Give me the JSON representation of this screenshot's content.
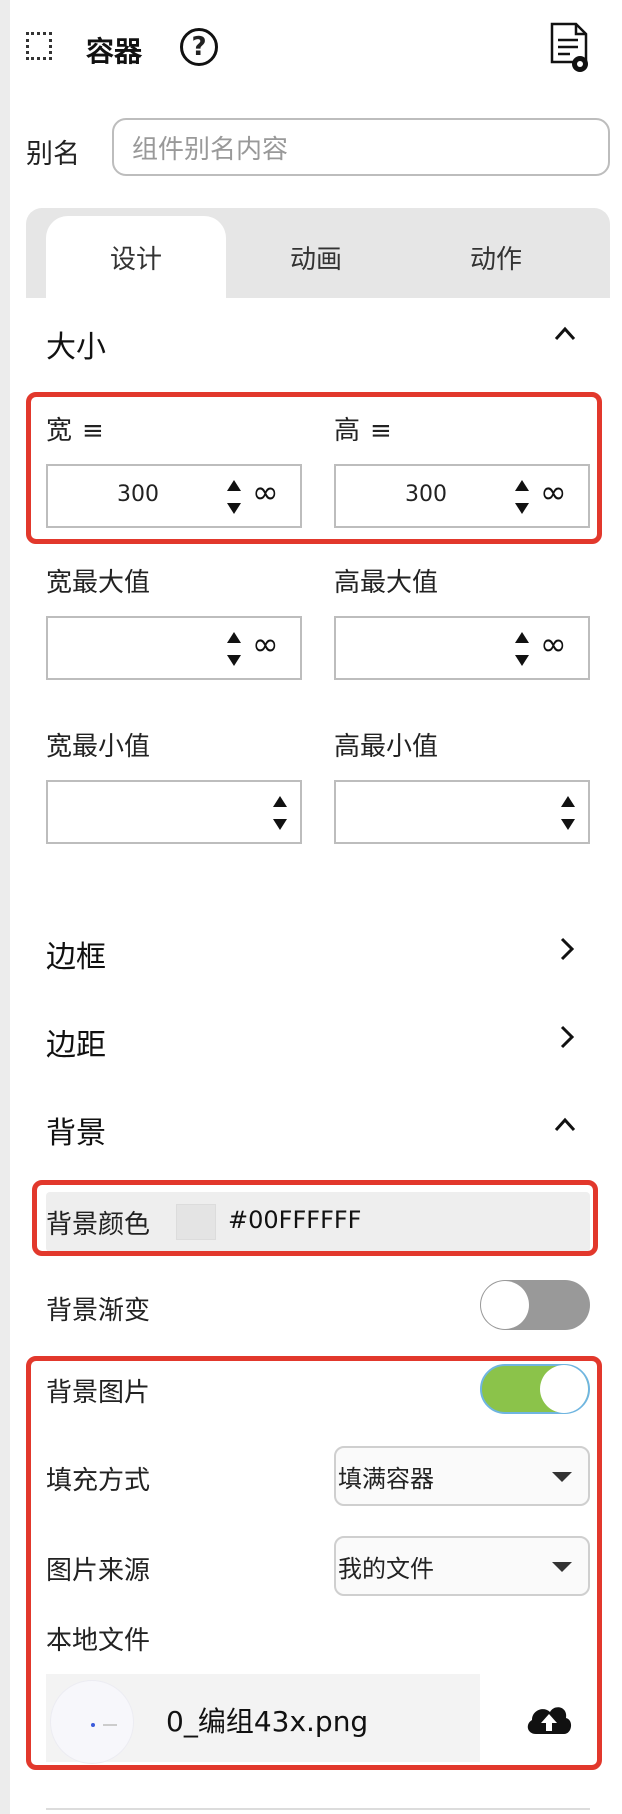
{
  "header": {
    "title": "容器",
    "help_icon_glyph": "?"
  },
  "alias": {
    "label": "别名",
    "placeholder": "组件别名内容"
  },
  "tabs": [
    {
      "label": "设计",
      "active": true
    },
    {
      "label": "动画",
      "active": false
    },
    {
      "label": "动作",
      "active": false
    }
  ],
  "size_section": {
    "title": "大小",
    "expanded": true,
    "width": {
      "label": "宽",
      "value": "300"
    },
    "height": {
      "label": "高",
      "value": "300"
    },
    "max_width": {
      "label": "宽最大值",
      "value": ""
    },
    "max_height": {
      "label": "高最大值",
      "value": ""
    },
    "min_width": {
      "label": "宽最小值",
      "value": ""
    },
    "min_height": {
      "label": "高最小值",
      "value": ""
    },
    "unit_glyph": "≡",
    "infinity_glyph": "∞"
  },
  "border_section": {
    "title": "边框",
    "expanded": false
  },
  "margin_section": {
    "title": "边距",
    "expanded": false
  },
  "background_section": {
    "title": "背景",
    "expanded": true,
    "color": {
      "label": "背景颜色",
      "value": "#00FFFFFF"
    },
    "gradient": {
      "label": "背景渐变",
      "enabled": false
    },
    "image": {
      "label": "背景图片",
      "enabled": true
    },
    "fill_mode": {
      "label": "填充方式",
      "value": "填满容器"
    },
    "image_source": {
      "label": "图片来源",
      "value": "我的文件"
    },
    "local_file": {
      "label": "本地文件",
      "file_name": "0_编组43x.png"
    }
  },
  "colors": {
    "highlight": "#e2382c",
    "toggle_on": "#8bc34a",
    "toggle_off": "#999999"
  }
}
